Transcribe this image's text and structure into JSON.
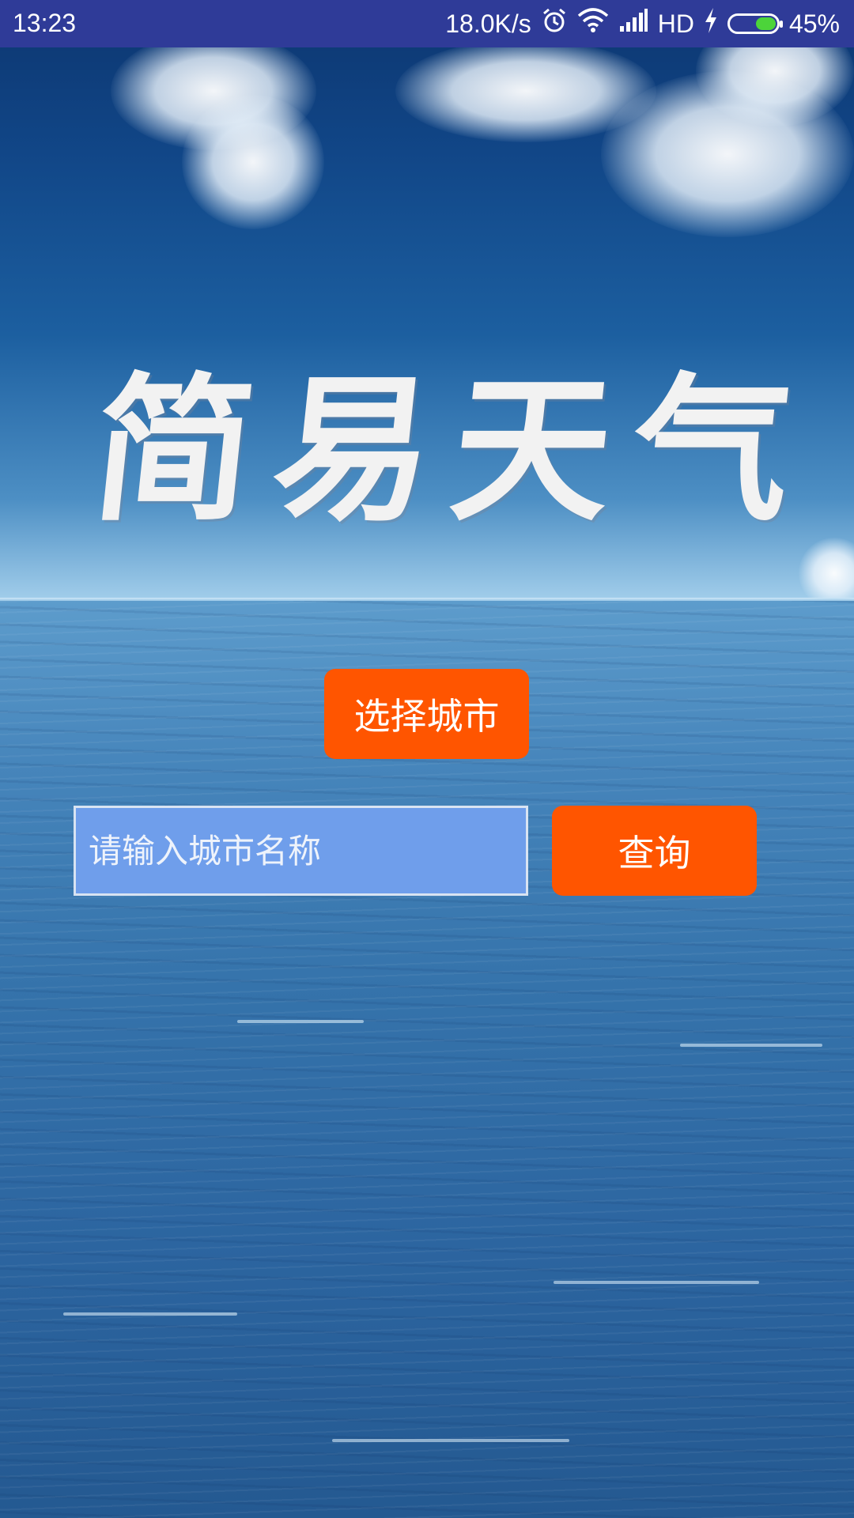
{
  "status_bar": {
    "time": "13:23",
    "network_speed": "18.0K/s",
    "network_type": "HD",
    "battery_percent": "45%",
    "battery_level": 0.45,
    "icons": [
      "alarm-icon",
      "wifi-icon",
      "signal-icon",
      "charging-icon",
      "battery-icon"
    ]
  },
  "app": {
    "title_chars": [
      "简",
      "易",
      "天",
      "气"
    ]
  },
  "controls": {
    "select_city_label": "选择城市",
    "city_input_placeholder": "请输入城市名称",
    "city_input_value": "",
    "query_label": "查询"
  },
  "colors": {
    "status_bar": "#2f3b98",
    "button": "#ff5500",
    "input_background": "#6f9eeb"
  }
}
